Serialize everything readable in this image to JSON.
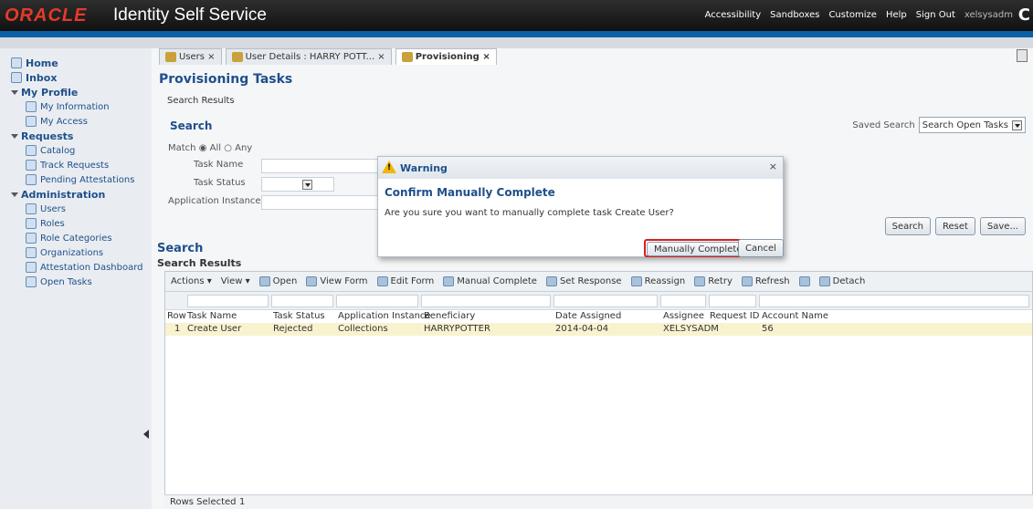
{
  "header": {
    "brand": "ORACLE",
    "title": "Identity Self Service",
    "links": [
      "Accessibility",
      "Sandboxes",
      "Customize",
      "Help",
      "Sign Out"
    ],
    "user": "xelsysadm"
  },
  "sidebar": {
    "home": "Home",
    "inbox": "Inbox",
    "my_profile": "My Profile",
    "my_information": "My Information",
    "my_access": "My Access",
    "requests": "Requests",
    "catalog": "Catalog",
    "track_requests": "Track Requests",
    "pending_attestations": "Pending Attestations",
    "administration": "Administration",
    "users": "Users",
    "roles": "Roles",
    "role_categories": "Role Categories",
    "organizations": "Organizations",
    "attestation_dashboard": "Attestation Dashboard",
    "open_tasks": "Open Tasks"
  },
  "tabs": [
    {
      "label": "Users ×"
    },
    {
      "label": "User Details : HARRY POTT... ×"
    },
    {
      "label": "Provisioning ×"
    }
  ],
  "page": {
    "title": "Provisioning Tasks",
    "search_results_link": "Search Results",
    "search_heading": "Search",
    "saved_search_label": "Saved Search",
    "saved_search_value": "Search Open Tasks",
    "match_label": "Match",
    "match_all": "All",
    "match_any": "Any",
    "task_name_label": "Task Name",
    "task_status_label": "Task Status",
    "app_instance_label": "Application Instance",
    "search_btn": "Search",
    "reset_btn": "Reset",
    "save_btn": "Save...",
    "results_heading": "Search",
    "results_sub": "Search Results"
  },
  "toolbar": {
    "actions": "Actions ▾",
    "view": "View ▾",
    "open": "Open",
    "view_form": "View Form",
    "edit_form": "Edit Form",
    "manual_complete": "Manual Complete",
    "set_response": "Set Response",
    "reassign": "Reassign",
    "retry": "Retry",
    "refresh": "Refresh",
    "detach": "Detach"
  },
  "table": {
    "headers": [
      "Row",
      "Task Name",
      "Task Status",
      "Application Instance",
      "Beneficiary",
      "Date Assigned",
      "Assignee",
      "Request ID",
      "Account Name"
    ],
    "rows": [
      [
        "1",
        "Create User",
        "Rejected",
        "Collections",
        "HARRYPOTTER",
        "2014-04-04",
        "XELSYSADM",
        "",
        "56"
      ]
    ]
  },
  "status": {
    "rows_selected_label": "Rows Selected",
    "rows_selected_value": "1"
  },
  "dialog": {
    "title": "Warning",
    "close": "×",
    "heading": "Confirm Manually Complete",
    "message": "Are you sure you want to manually complete task Create User?",
    "confirm": "Manually Complete",
    "cancel": "Cancel"
  },
  "colors": {
    "accent": "#0b5fa5",
    "brand": "#e53a2a",
    "highlight": "#d51f1f"
  }
}
